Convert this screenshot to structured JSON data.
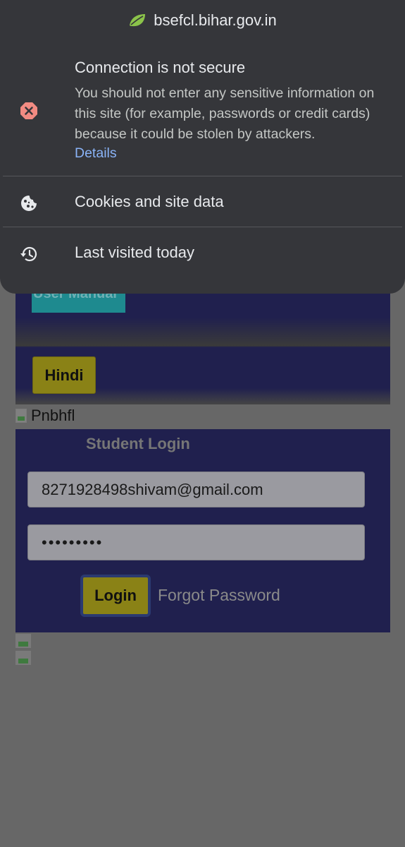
{
  "popup": {
    "host": "bsefcl.bihar.gov.in",
    "security": {
      "title": "Connection is not secure",
      "body": "You should not enter any sensitive information on this site (for example, passwords or credit cards) because it could be stolen by attackers.",
      "details_link": "Details",
      "icon": "warning-x-icon"
    },
    "items": [
      {
        "label": "Cookies and site data",
        "icon": "cookie-icon"
      },
      {
        "label": "Last visited today",
        "icon": "history-icon"
      }
    ]
  },
  "page": {
    "user_manual_button": "User Manual",
    "hindi_button": "Hindi",
    "broken_image_alt": "Pnbhfl",
    "login": {
      "title": "Student Login",
      "email_value": "8271928498shivam@gmail.com",
      "password_value": "•••••••••",
      "login_button": "Login",
      "forgot_link": "Forgot Password"
    }
  },
  "colors": {
    "popup_bg": "#35363a",
    "link": "#8ab4f8",
    "warning": "#f28b82",
    "page_overlay": "#676767",
    "button_yellow": "#8a8216"
  }
}
